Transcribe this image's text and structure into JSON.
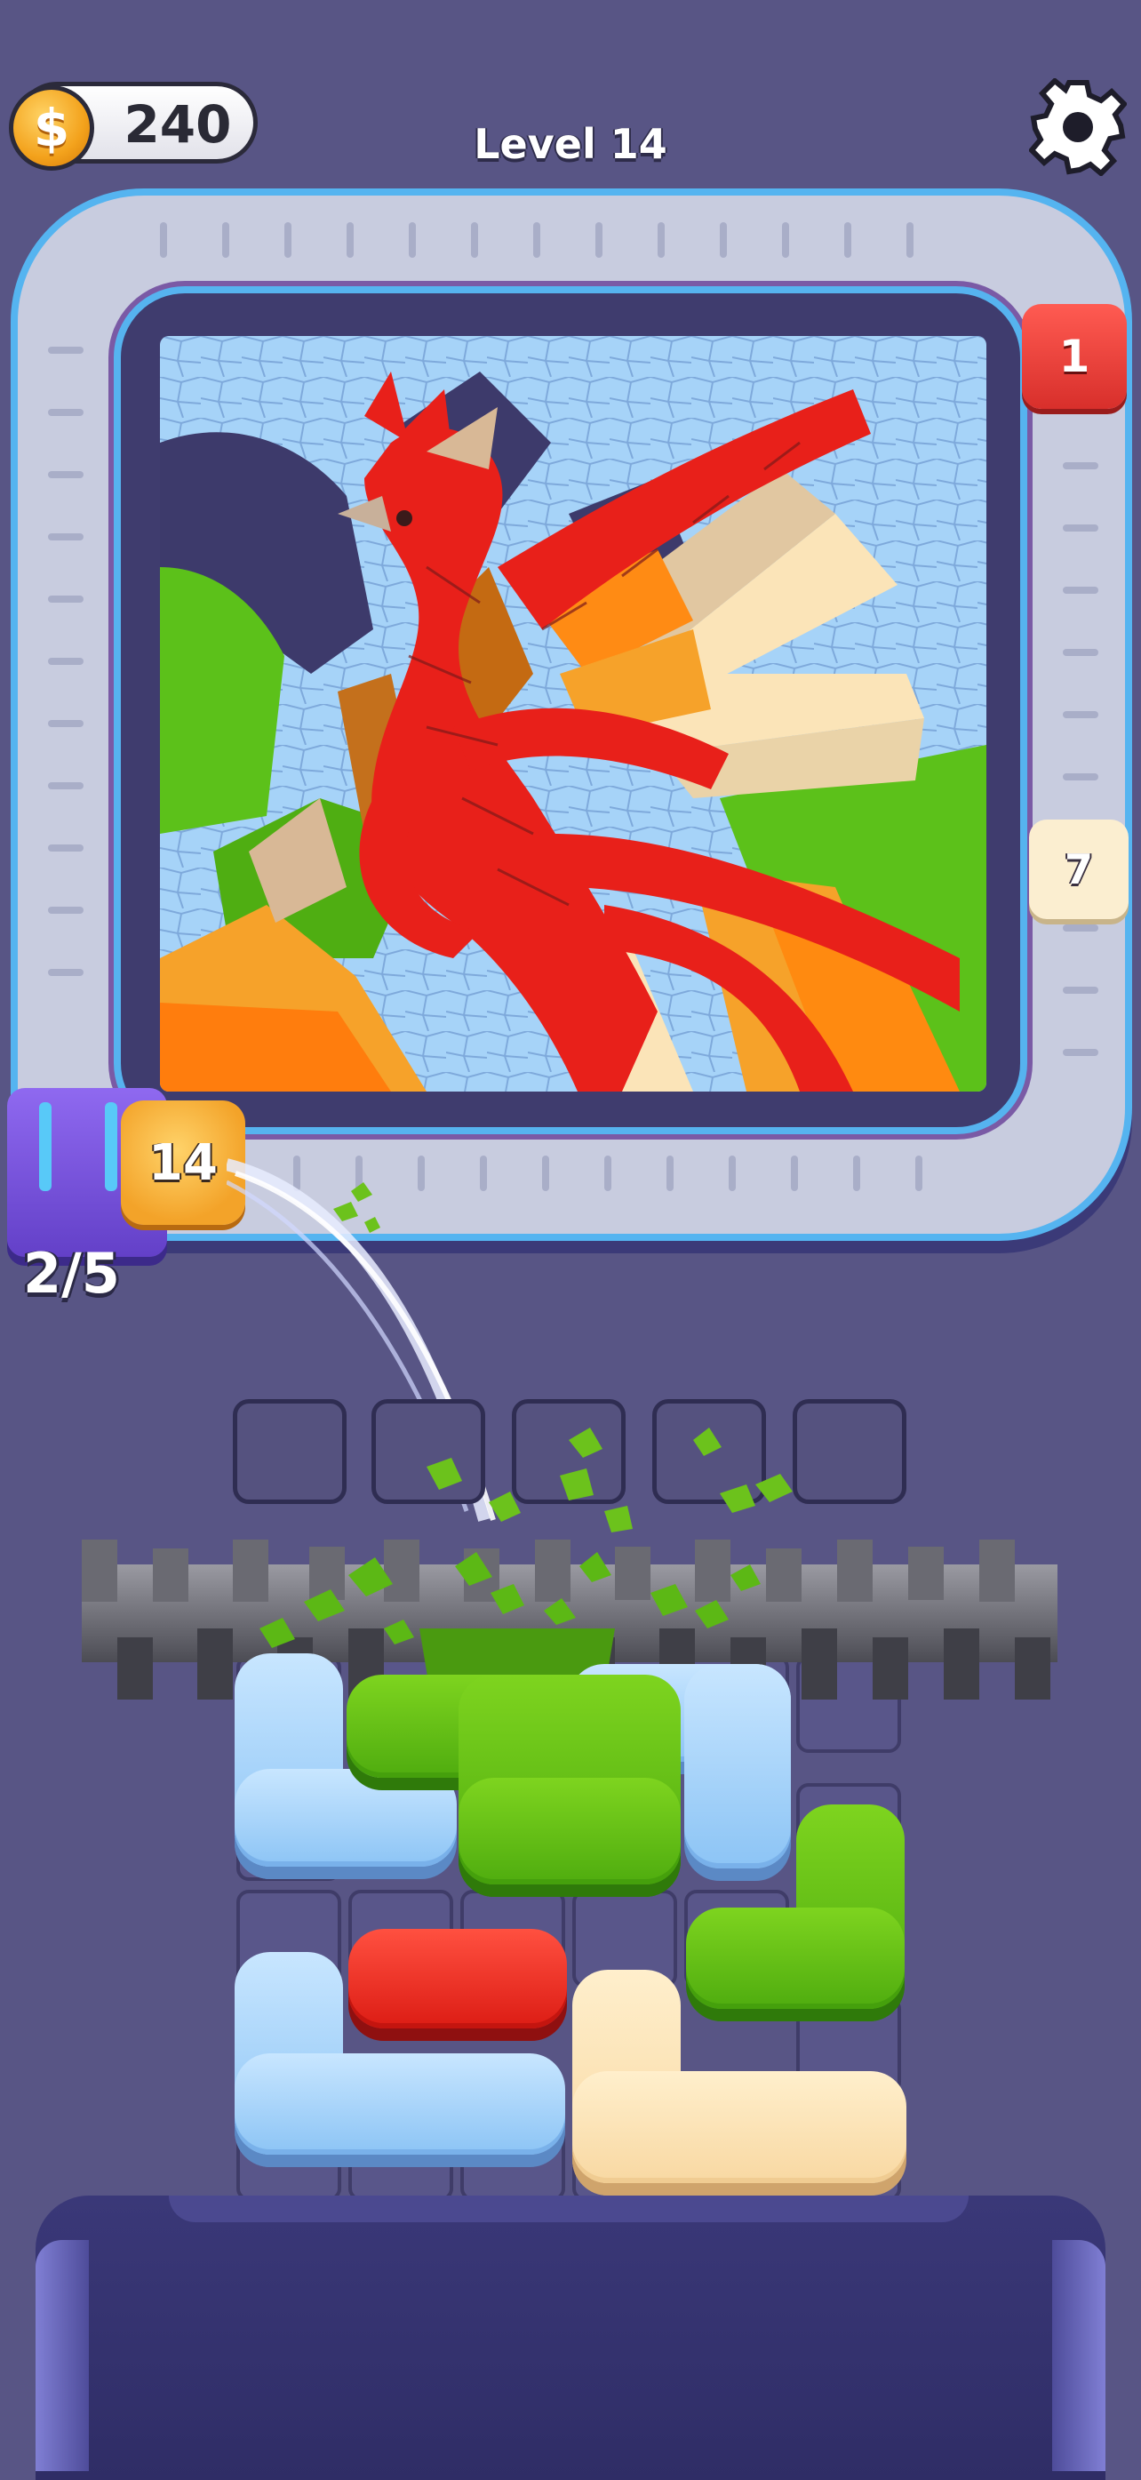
{
  "hud": {
    "coins": "240",
    "level_title": "Level 14",
    "coin_icon": "$",
    "coin_icon_name": "dollar-coin-icon",
    "settings_icon_name": "gear-icon"
  },
  "badges": {
    "red_count": "1",
    "cream_count": "7",
    "orange_count": "14"
  },
  "ammo": {
    "label": "2/5"
  },
  "colors": {
    "background": "#585585",
    "conveyor_border": "#55b4f0",
    "red": "#e82a1e",
    "orange": "#f6a22a",
    "green": "#5cc11a",
    "blue": "#9fd0fb",
    "cream": "#fbe4b8"
  }
}
